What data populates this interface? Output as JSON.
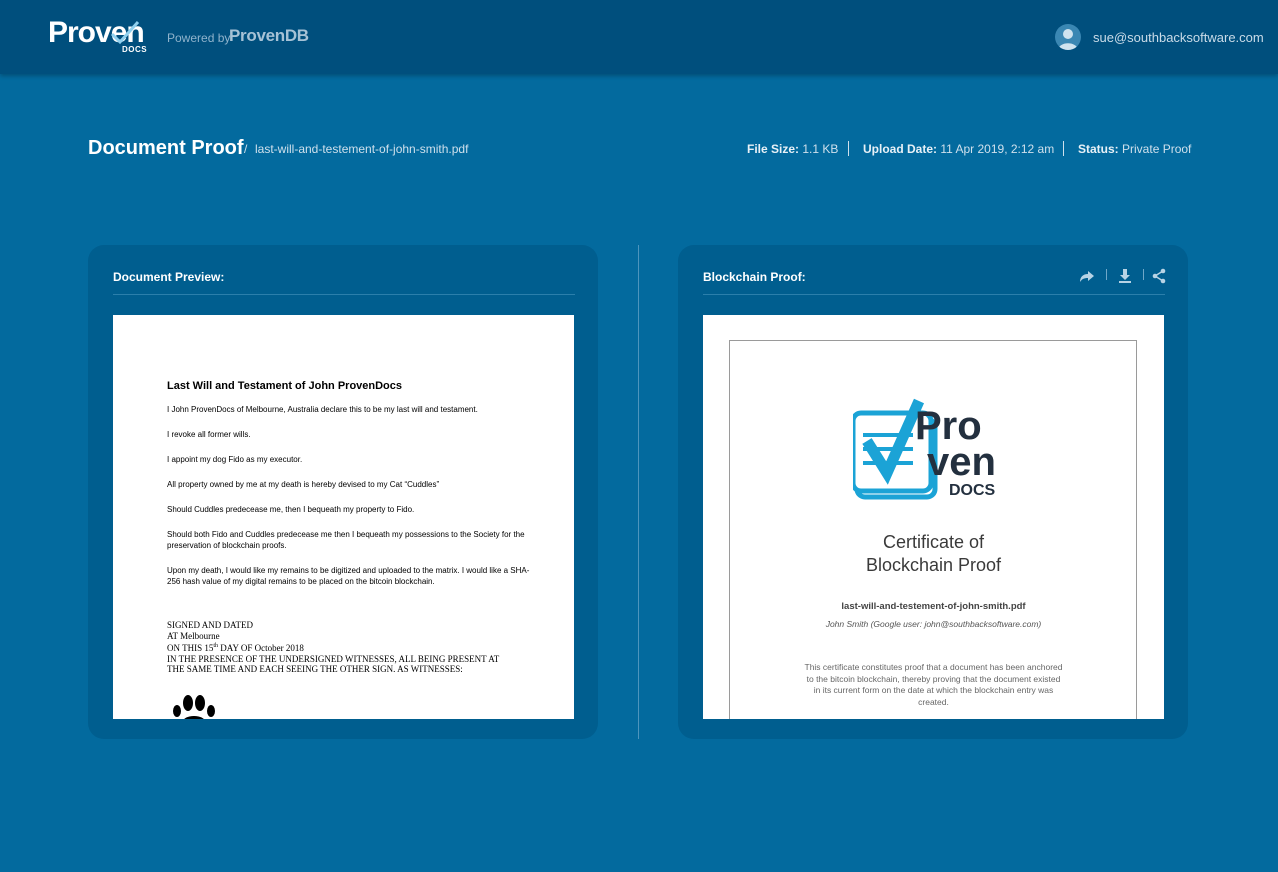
{
  "header": {
    "logo_text": "Proven",
    "logo_subtext": "DOCS",
    "powered_by_label": "Powered by",
    "powered_by_brand": "ProvenDB",
    "user_email": "sue@southbacksoftware.com"
  },
  "title_row": {
    "page_title": "Document Proof",
    "separator": "/",
    "file_name": "last-will-and-testement-of-john-smith.pdf",
    "file_size_label": "File Size:",
    "file_size_value": "1.1 KB",
    "upload_date_label": "Upload Date:",
    "upload_date_value": "11 Apr 2019, 2:12 am",
    "status_label": "Status:",
    "status_value": "Private Proof"
  },
  "document_preview": {
    "title": "Document Preview:",
    "doc": {
      "heading": "Last Will and Testament of John ProvenDocs",
      "paragraphs": [
        "I John ProvenDocs of Melbourne, Australia declare this to be my last will and testament.",
        "I revoke all former wills.",
        "I appoint my dog Fido as my executor.",
        "All property owned by me at my death is hereby devised to my Cat “Cuddles”",
        "Should Cuddles predecease me, then I bequeath my property to Fido.",
        "Should both Fido and Cuddles predecease me then I bequeath my possessions to the Society for the preservation of blockchain proofs.",
        "Upon my death, I would like my remains to be digitized and uploaded to the matrix.  I would like a SHA-256 hash value of my digital remains to be placed on the bitcoin blockchain."
      ],
      "signed_lines": {
        "line1": "SIGNED AND DATED",
        "line2": "AT Melbourne",
        "line3_a": "ON THIS  15",
        "line3_sup": "th",
        "line3_b": " DAY OF October 2018",
        "line4": "IN THE PRESENCE OF THE UNDERSIGNED WITNESSES, ALL BEING PRESENT AT",
        "line5": "THE SAME TIME AND EACH SEEING THE OTHER SIGN. AS WITNESSES:"
      }
    }
  },
  "blockchain_proof": {
    "title": "Blockchain Proof:",
    "toolbar": [
      "share-arrow-icon",
      "download-icon",
      "share-nodes-icon"
    ],
    "certificate": {
      "logo_line1": "Pro",
      "logo_line2": "ven",
      "logo_line3": "DOCS",
      "title_line1": "Certificate of",
      "title_line2": "Blockchain Proof",
      "file_name": "last-will-and-testement-of-john-smith.pdf",
      "user_line": "John Smith (Google user: john@southbacksoftware.com)",
      "description": "This certificate constitutes proof that a document has been anchored to the bitcoin blockchain, thereby proving that the document existed in its current form on the date at which the blockchain entry was created."
    }
  },
  "colors": {
    "background": "#036a9e",
    "header": "#004f7d",
    "panel": "#005e8f",
    "logo_blue": "#1ba3d6",
    "logo_dark": "#23303f"
  }
}
